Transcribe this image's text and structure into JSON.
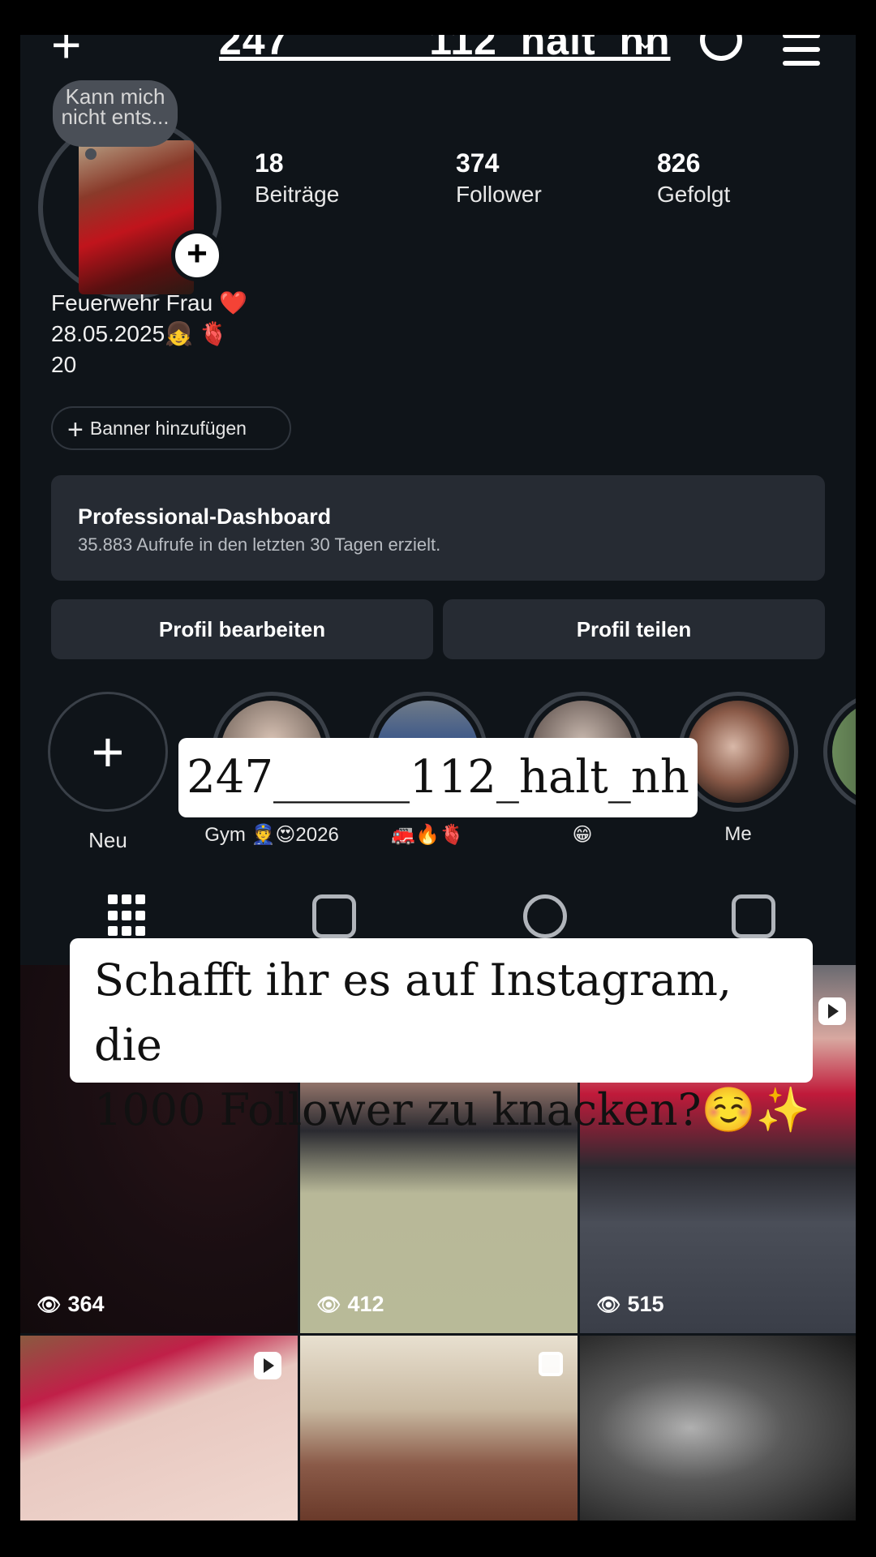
{
  "header": {
    "username": "247______112_halt_nh",
    "create_icon": "plus-icon",
    "chevron_icon": "chevron-down-icon",
    "threads_icon": "threads-icon",
    "menu_icon": "hamburger-icon"
  },
  "profile": {
    "note": "Kann mich nicht ents...",
    "stats": [
      {
        "value": "18",
        "label": "Beiträge"
      },
      {
        "value": "374",
        "label": "Follower"
      },
      {
        "value": "826",
        "label": "Gefolgt"
      }
    ],
    "bio_lines": [
      "Feuerwehr Frau ❤️",
      "28.05.2025👧 🫀",
      "20"
    ],
    "banner_button": "Banner hinzufügen",
    "dashboard_title": "Professional-Dashboard",
    "dashboard_subtitle": "35.883 Aufrufe in den letzten 30 Tagen erzielt.",
    "edit_button": "Profil bearbeiten",
    "share_button": "Profil teilen"
  },
  "highlights": [
    {
      "label": "Neu"
    },
    {
      "label": "Gym 👮😍2026"
    },
    {
      "label": "🚒🔥🫀"
    },
    {
      "label": "😁"
    },
    {
      "label": "Me"
    }
  ],
  "overlays": {
    "username_caption": "247______112_halt_nh",
    "question_line1": "Schafft ihr es auf Instagram, die",
    "question_line2": "1000 Follower zu knacken?☺️✨"
  },
  "tabs": [
    "grid-icon",
    "reels-icon",
    "reposts-icon",
    "tagged-icon"
  ],
  "posts": [
    {
      "views": "364"
    },
    {
      "views": "412"
    },
    {
      "views": "515"
    }
  ]
}
